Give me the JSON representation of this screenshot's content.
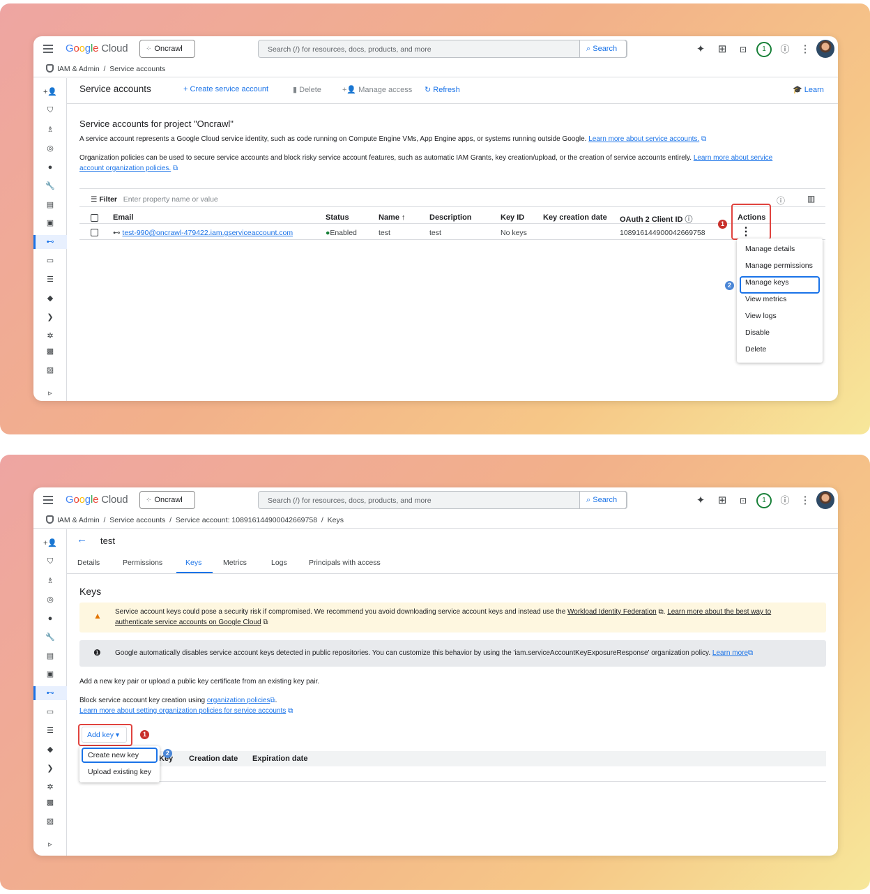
{
  "top": {
    "logo_google": "Google",
    "logo_cloud": "Cloud",
    "project": "Oncrawl",
    "search_placeholder": "Search (/) for resources, docs, products, and more",
    "search_button": "Search",
    "notif_count": "1"
  },
  "panel1": {
    "breadcrumb": [
      "IAM & Admin",
      "Service accounts"
    ],
    "toolbar": {
      "title": "Service accounts",
      "create": "Create service account",
      "delete": "Delete",
      "manage_access": "Manage access",
      "refresh": "Refresh",
      "learn": "Learn"
    },
    "heading": "Service accounts for project \"Oncrawl\"",
    "desc": "A service account represents a Google Cloud service identity, such as code running on Compute Engine VMs, App Engine apps, or systems running outside Google.",
    "desc_link": "Learn more about service accounts.",
    "org_text": "Organization policies can be used to secure service accounts and block risky service account features, such as automatic IAM Grants, key creation/upload, or the creation of service accounts entirely.",
    "org_link1": "Learn more about service",
    "org_link2": "account organization policies.",
    "filter_label": "Filter",
    "filter_placeholder": "Enter property name or value",
    "columns": [
      "Email",
      "Status",
      "Name",
      "Description",
      "Key ID",
      "Key creation date",
      "OAuth 2 Client ID",
      "Actions"
    ],
    "row": {
      "email": "test-990@oncrawl-479422.iam.gserviceaccount.com",
      "status": "Enabled",
      "name": "test",
      "description": "test",
      "key_id": "No keys",
      "key_creation_date": "",
      "oauth_id": "108916144900042669758"
    },
    "actions_menu": [
      "Manage details",
      "Manage permissions",
      "Manage keys",
      "View metrics",
      "View logs",
      "Disable",
      "Delete"
    ],
    "step1": "1",
    "step2": "2"
  },
  "panel2": {
    "breadcrumb": [
      "IAM & Admin",
      "Service accounts",
      "Service account: 108916144900042669758",
      "Keys"
    ],
    "title": "test",
    "tabs": [
      "Details",
      "Permissions",
      "Keys",
      "Metrics",
      "Logs",
      "Principals with access"
    ],
    "heading": "Keys",
    "warning_text": "Service account keys could pose a security risk if compromised. We recommend you avoid downloading service account keys and instead use the",
    "warning_link1": "Workload Identity Federation",
    "warning_mid": ".",
    "warning_link2": "Learn more about the best way to",
    "warning_link3": "authenticate service accounts on Google Cloud",
    "info_text": "Google automatically disables service account keys detected in public repositories. You can customize this behavior by using the 'iam.serviceAccountKeyExposureResponse' organization policy.",
    "info_link": "Learn more",
    "add_text": "Add a new key pair or upload a public key certificate from an existing key pair.",
    "block_text": "Block service account key creation using",
    "block_link": "organization policies",
    "learn_org_link": "Learn more about setting organization policies for service accounts",
    "add_key": "Add key",
    "add_key_menu": [
      "Create new key",
      "Upload existing key"
    ],
    "columns": [
      "Key",
      "Creation date",
      "Expiration date"
    ],
    "step1": "1",
    "step2": "2"
  }
}
